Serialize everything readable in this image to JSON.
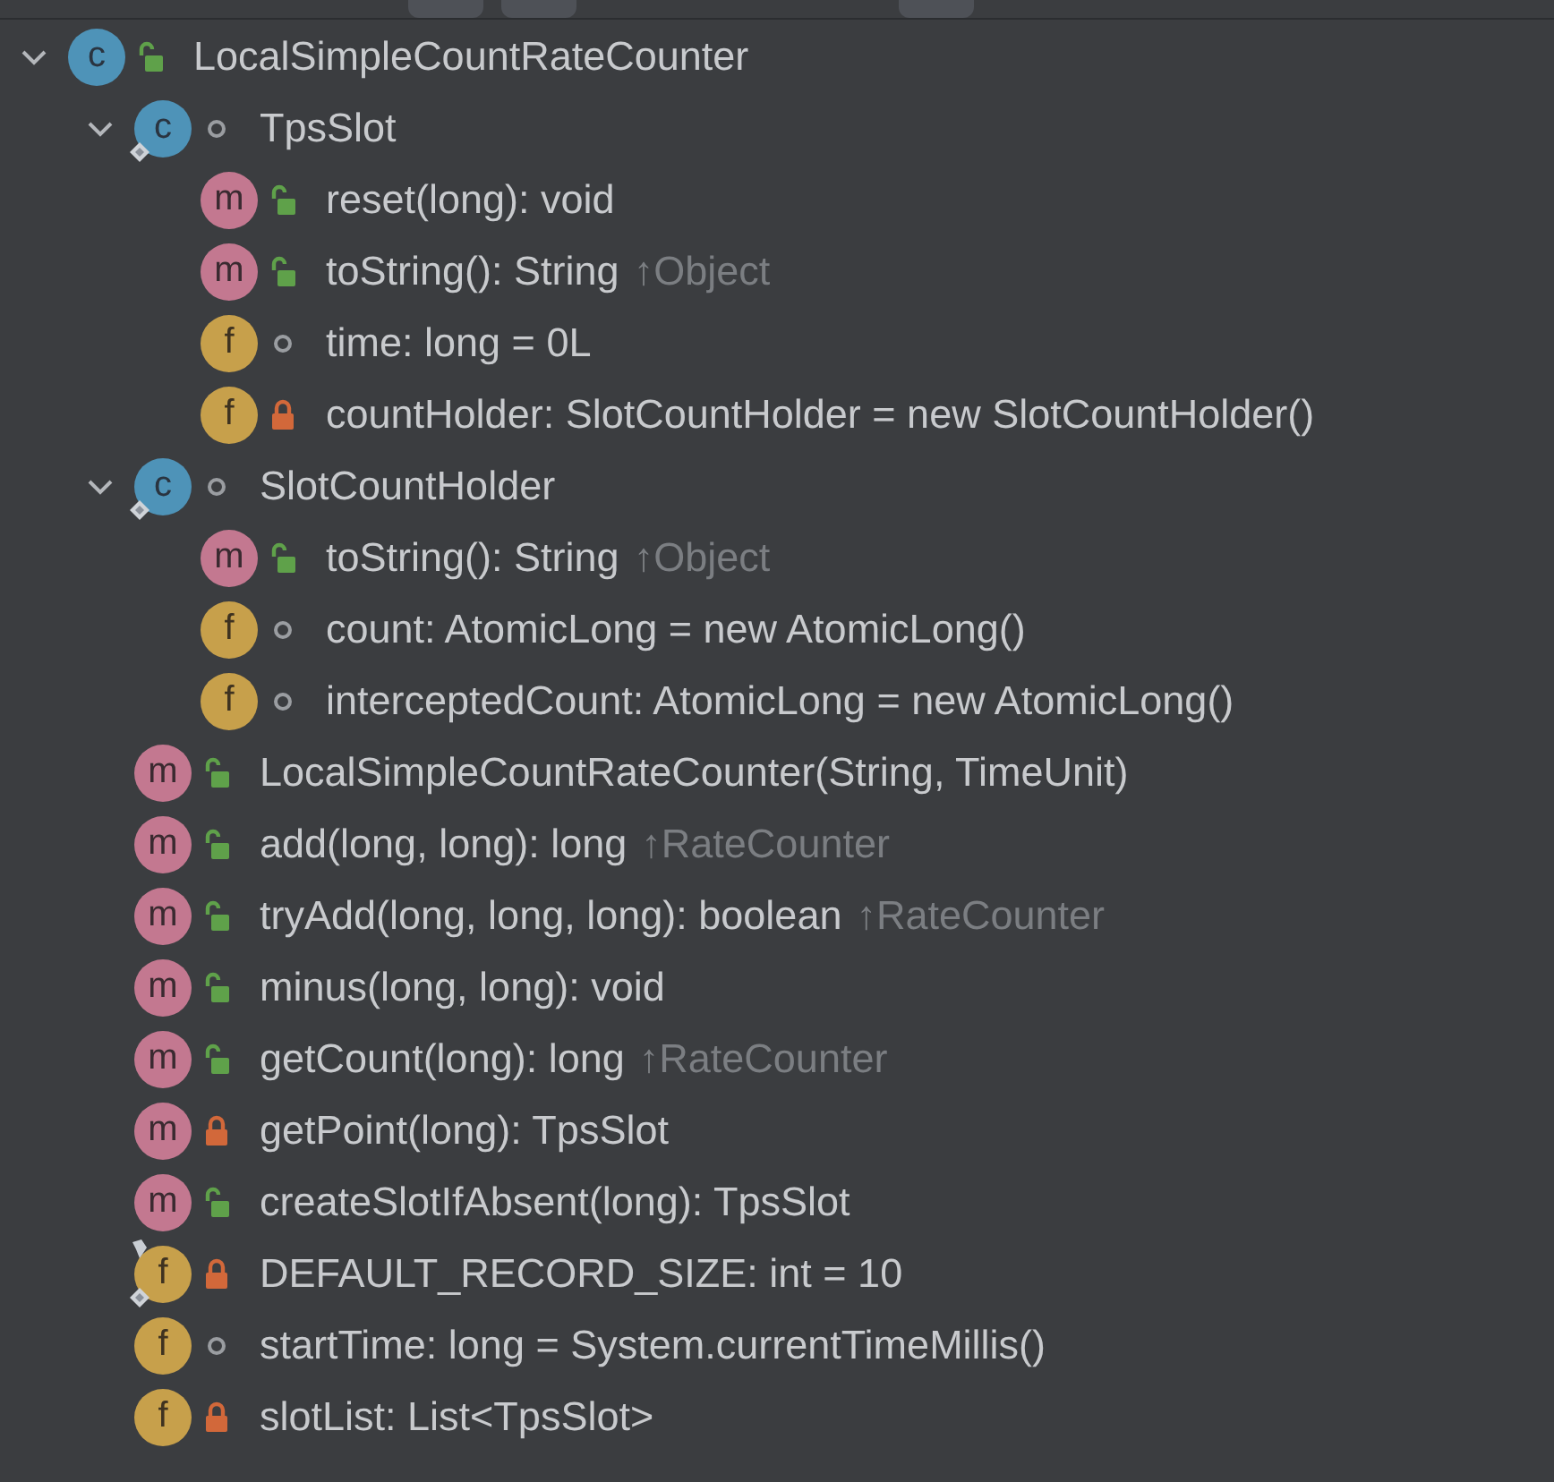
{
  "tree": [
    {
      "kind": "class",
      "badge": "c",
      "access": {
        "kind": "public"
      },
      "expanded": true,
      "label": "LocalSimpleCountRateCounter",
      "children": [
        {
          "kind": "class",
          "badge": "c",
          "access": {
            "kind": "package"
          },
          "static": true,
          "expanded": true,
          "label": "TpsSlot",
          "children": [
            {
              "kind": "method",
              "badge": "m",
              "access": {
                "kind": "public"
              },
              "label": "reset(long): void"
            },
            {
              "kind": "method",
              "badge": "m",
              "access": {
                "kind": "public"
              },
              "label": "toString(): String",
              "origin": "↑Object"
            },
            {
              "kind": "field",
              "badge": "f",
              "access": {
                "kind": "package"
              },
              "label": "time: long = 0L"
            },
            {
              "kind": "field",
              "badge": "f",
              "access": {
                "kind": "private"
              },
              "label": "countHolder: SlotCountHolder = new SlotCountHolder()"
            }
          ]
        },
        {
          "kind": "class",
          "badge": "c",
          "access": {
            "kind": "package"
          },
          "static": true,
          "expanded": true,
          "label": "SlotCountHolder",
          "children": [
            {
              "kind": "method",
              "badge": "m",
              "access": {
                "kind": "public"
              },
              "label": "toString(): String",
              "origin": "↑Object"
            },
            {
              "kind": "field",
              "badge": "f",
              "access": {
                "kind": "package"
              },
              "label": "count: AtomicLong = new AtomicLong()"
            },
            {
              "kind": "field",
              "badge": "f",
              "access": {
                "kind": "package"
              },
              "label": "interceptedCount: AtomicLong = new AtomicLong()"
            }
          ]
        },
        {
          "kind": "method",
          "badge": "m",
          "access": {
            "kind": "public"
          },
          "label": "LocalSimpleCountRateCounter(String, TimeUnit)"
        },
        {
          "kind": "method",
          "badge": "m",
          "access": {
            "kind": "public"
          },
          "label": "add(long, long): long",
          "origin": "↑RateCounter"
        },
        {
          "kind": "method",
          "badge": "m",
          "access": {
            "kind": "public"
          },
          "label": "tryAdd(long, long, long): boolean",
          "origin": "↑RateCounter"
        },
        {
          "kind": "method",
          "badge": "m",
          "access": {
            "kind": "public"
          },
          "label": "minus(long, long): void"
        },
        {
          "kind": "method",
          "badge": "m",
          "access": {
            "kind": "public"
          },
          "label": "getCount(long): long",
          "origin": "↑RateCounter"
        },
        {
          "kind": "method",
          "badge": "m",
          "access": {
            "kind": "private"
          },
          "label": "getPoint(long): TpsSlot"
        },
        {
          "kind": "method",
          "badge": "m",
          "access": {
            "kind": "public"
          },
          "label": "createSlotIfAbsent(long): TpsSlot"
        },
        {
          "kind": "field",
          "badge": "f",
          "access": {
            "kind": "private"
          },
          "static": true,
          "final": true,
          "label": "DEFAULT_RECORD_SIZE: int = 10"
        },
        {
          "kind": "field",
          "badge": "f",
          "access": {
            "kind": "package"
          },
          "label": "startTime: long = System.currentTimeMillis()"
        },
        {
          "kind": "field",
          "badge": "f",
          "access": {
            "kind": "private"
          },
          "label": "slotList: List<TpsSlot>"
        }
      ]
    }
  ]
}
